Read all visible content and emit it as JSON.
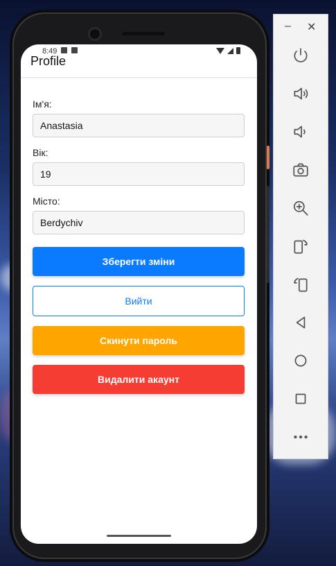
{
  "app": {
    "title": "Profile"
  },
  "status_bar": {
    "time": "8:49"
  },
  "form": {
    "name_label": "Ім'я:",
    "name_value": "Anastasia",
    "age_label": "Вік:",
    "age_value": "19",
    "city_label": "Місто:",
    "city_value": "Berdychiv"
  },
  "buttons": {
    "save": "Зберегти зміни",
    "logout": "Вийти",
    "reset_password": "Скинути пароль",
    "delete_account": "Видалити акаунт"
  },
  "colors": {
    "primary": "#0a7bff",
    "warning": "#ffa500",
    "danger": "#f53d34"
  },
  "emulator_panel": {
    "minimize": "–",
    "close": "✕",
    "controls": [
      "power-icon",
      "volume-up-icon",
      "volume-down-icon",
      "camera-icon",
      "zoom-in-icon",
      "rotate-left-icon",
      "rotate-right-icon",
      "back-icon",
      "home-icon",
      "overview-icon",
      "more-icon"
    ]
  }
}
